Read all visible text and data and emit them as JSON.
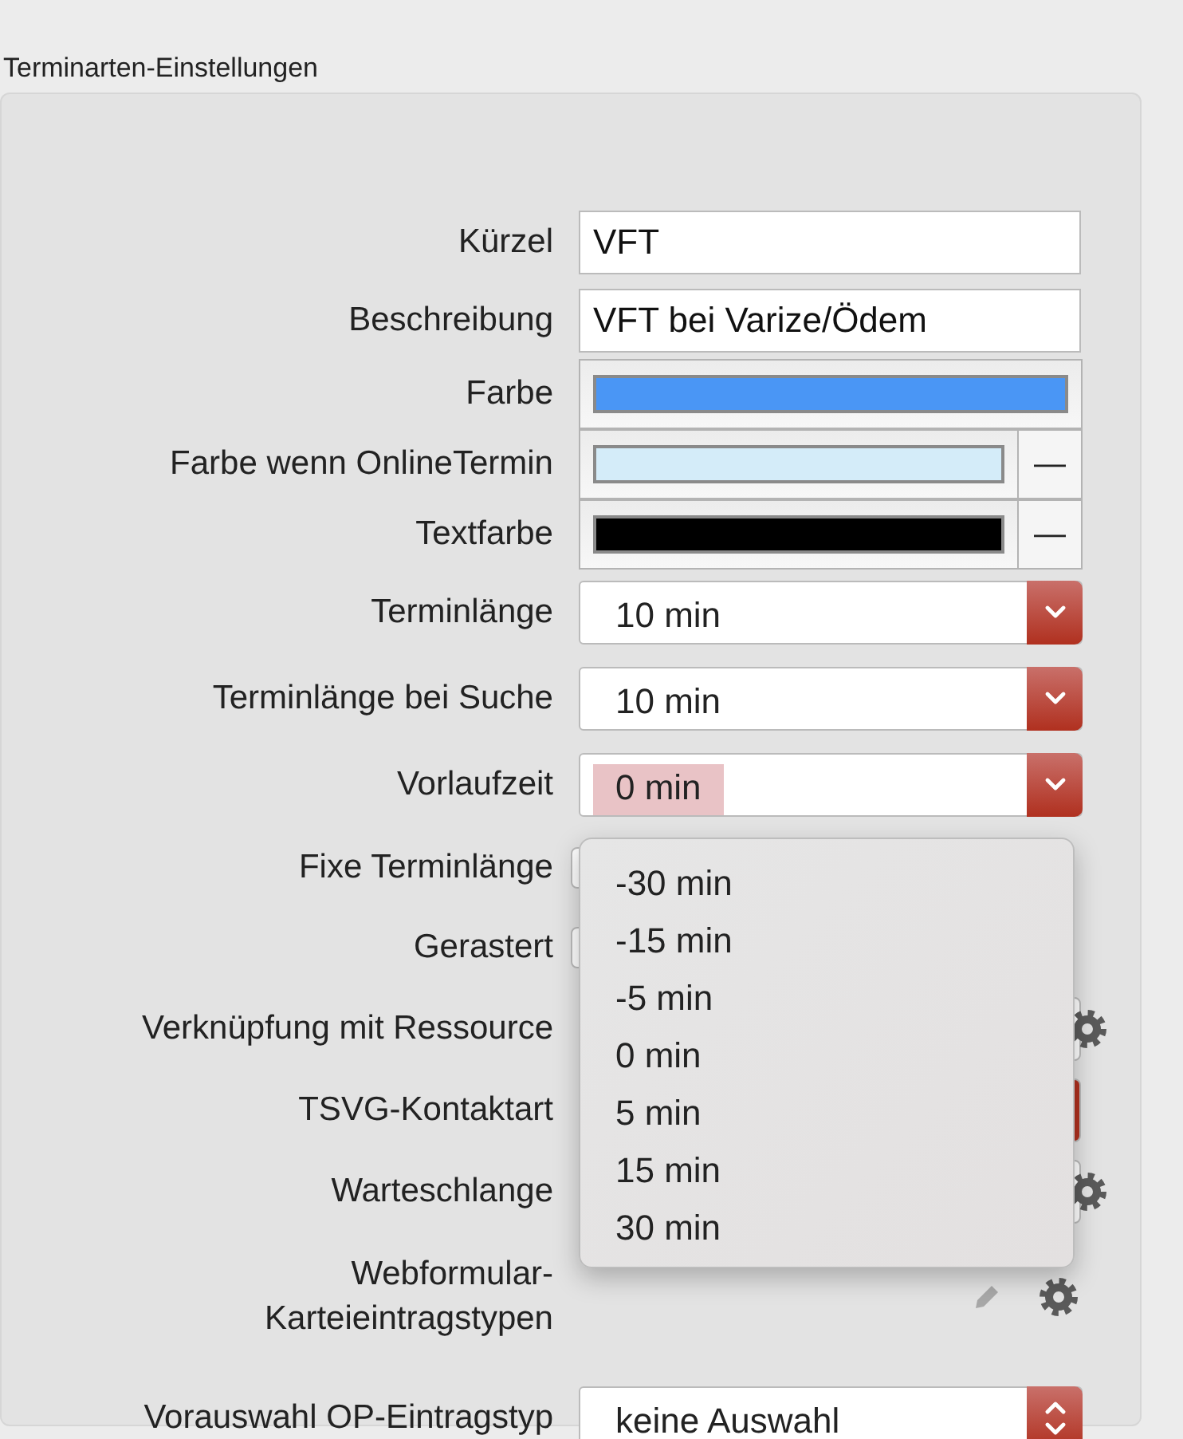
{
  "title": "Terminarten-Einstellungen",
  "rows": [
    {
      "label": "Kürzel",
      "control": {
        "kind": "text",
        "value": "VFT"
      }
    },
    {
      "label": "Beschreibung",
      "control": {
        "kind": "text",
        "value": "VFT bei Varize/Ödem"
      }
    },
    {
      "label": "Farbe",
      "control": {
        "kind": "color",
        "color": "#4a96f5"
      }
    },
    {
      "label": "Farbe wenn OnlineTermin",
      "control": {
        "kind": "color",
        "color": "#d4ecf9",
        "clear": "—"
      }
    },
    {
      "label": "Textfarbe",
      "control": {
        "kind": "color",
        "color": "#000000",
        "clear": "—"
      }
    },
    {
      "label": "Terminlänge",
      "control": {
        "kind": "select",
        "value": "10 min",
        "highlighted": false
      }
    },
    {
      "label": "Terminlänge bei Suche",
      "control": {
        "kind": "select",
        "value": "10 min",
        "highlighted": false
      }
    },
    {
      "label": "Vorlaufzeit",
      "control": {
        "kind": "select",
        "value": "0 min",
        "highlighted": true,
        "open": true
      }
    },
    {
      "label": "Fixe Terminlänge",
      "control": {
        "kind": "checkbox"
      }
    },
    {
      "label": "Gerastert",
      "control": {
        "kind": "checkbox"
      }
    },
    {
      "label": "Verknüpfung mit Ressource",
      "control": {
        "kind": "gear-select"
      }
    },
    {
      "label": "TSVG-Kontaktart",
      "control": {
        "kind": "covered-select"
      }
    },
    {
      "label": "Warteschlange",
      "control": {
        "kind": "gear-select"
      }
    },
    {
      "label": "Webformular-\nKarteieintragstypen",
      "control": {
        "kind": "edit-gear"
      }
    },
    {
      "label": "Vorauswahl OP-Eintragstyp",
      "control": {
        "kind": "stepper",
        "value": "keine Auswahl"
      }
    }
  ],
  "popup": {
    "items": [
      {
        "label": "-30 min",
        "selected": false
      },
      {
        "label": "-15 min",
        "selected": false
      },
      {
        "label": "-5 min",
        "selected": false
      },
      {
        "label": "0 min",
        "selected": false
      },
      {
        "label": "5 min",
        "selected": false
      },
      {
        "label": "15 min",
        "selected": false
      },
      {
        "label": "30 min",
        "selected": false
      }
    ]
  }
}
